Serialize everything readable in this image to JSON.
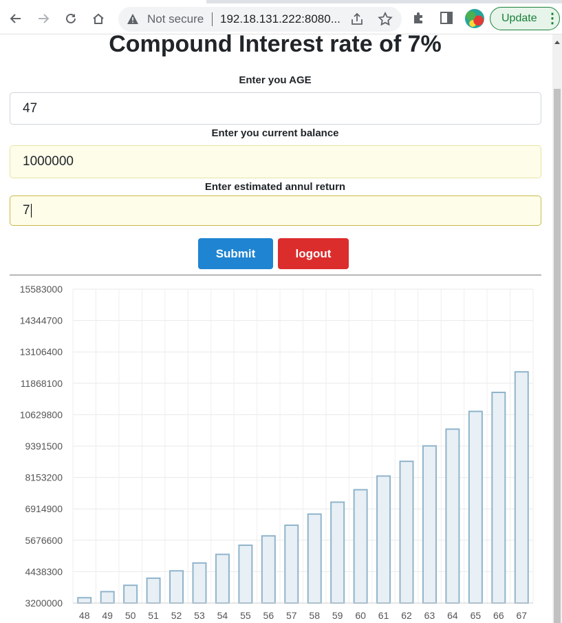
{
  "browser": {
    "not_secure": "Not secure",
    "url": "192.18.131.222:8080...",
    "update_label": "Update"
  },
  "page": {
    "title": "Compound Interest rate of 7%",
    "age_label": "Enter you AGE",
    "age_value": "47",
    "balance_label": "Enter you current balance",
    "balance_value": "1000000",
    "return_label": "Enter estimated annul return",
    "return_value": "7",
    "submit_label": "Submit",
    "logout_label": "logout"
  },
  "colors": {
    "submit": "#1f84d1",
    "logout": "#dc2d2d",
    "bar_fill": "#e8f0f5",
    "bar_stroke": "#8fb4cb"
  },
  "chart_data": {
    "type": "bar",
    "categories": [
      "48",
      "49",
      "50",
      "51",
      "52",
      "53",
      "54",
      "55",
      "56",
      "57",
      "58",
      "59",
      "60",
      "61",
      "62",
      "63",
      "64",
      "65",
      "66",
      "67"
    ],
    "values": [
      3410000,
      3650000,
      3900000,
      4180000,
      4470000,
      4780000,
      5120000,
      5480000,
      5850000,
      6270000,
      6710000,
      7180000,
      7670000,
      8210000,
      8790000,
      9400000,
      10060000,
      10760000,
      11510000,
      12320000
    ],
    "yticks": [
      "3200000",
      "4438300",
      "5676600",
      "6914900",
      "8153200",
      "9391500",
      "10629800",
      "11868100",
      "13106400",
      "14344700",
      "15583000"
    ],
    "ylim": [
      3200000,
      15583000
    ],
    "grid": true
  }
}
